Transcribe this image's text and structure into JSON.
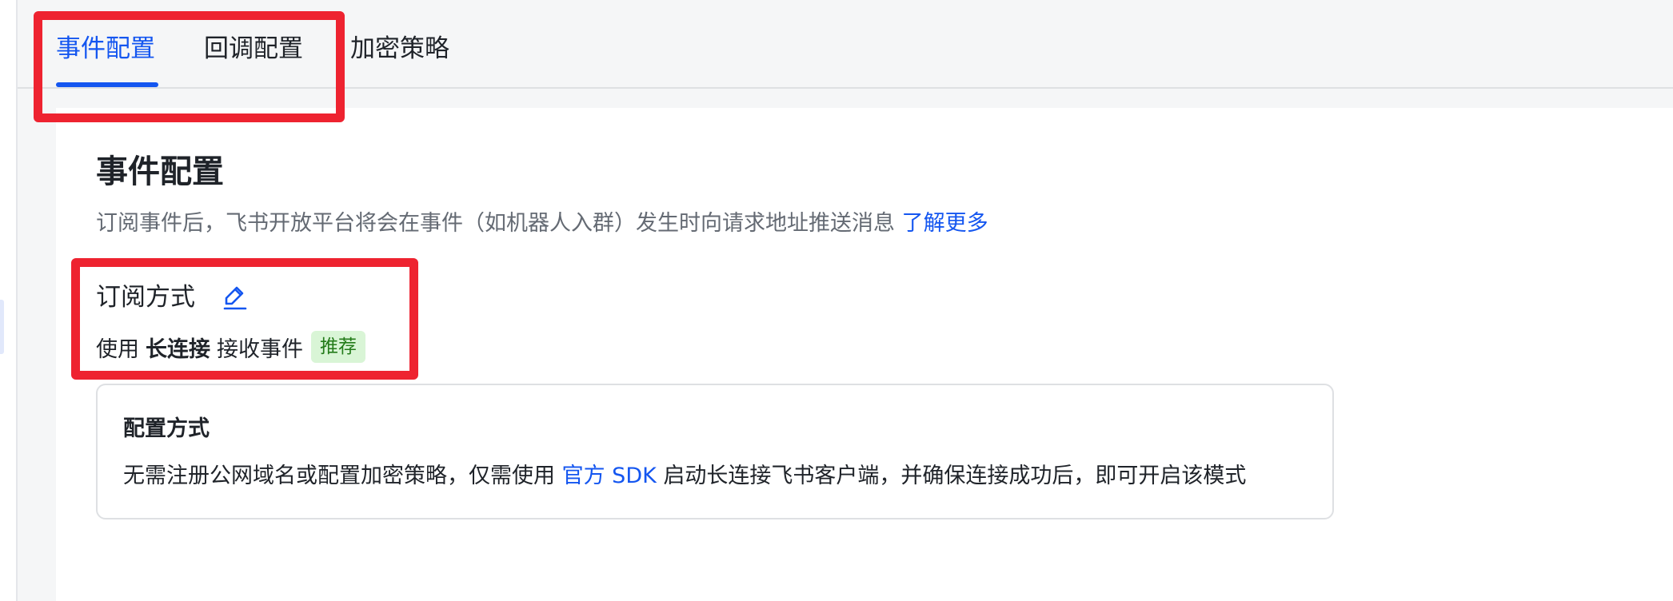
{
  "tabs": [
    {
      "label": "事件配置",
      "active": true
    },
    {
      "label": "回调配置",
      "active": false
    },
    {
      "label": "加密策略",
      "active": false
    }
  ],
  "page": {
    "title": "事件配置",
    "description": "订阅事件后，飞书开放平台将会在事件（如机器人入群）发生时向请求地址推送消息 ",
    "learn_more": "了解更多"
  },
  "subscription": {
    "title": "订阅方式",
    "edit_icon": "pencil-icon",
    "mode_prefix": "使用",
    "mode_strong": "长连接",
    "mode_suffix": "接收事件",
    "badge": "推荐"
  },
  "config_card": {
    "title": "配置方式",
    "text_before": "无需注册公网域名或配置加密策略，仅需使用 ",
    "link": "官方 SDK",
    "text_after": " 启动长连接飞书客户端，并确保连接成功后，即可开启该模式"
  },
  "colors": {
    "accent": "#1456f0",
    "highlight": "#ee2330",
    "badge_bg": "#d9f5d6",
    "badge_text": "#237b19"
  }
}
